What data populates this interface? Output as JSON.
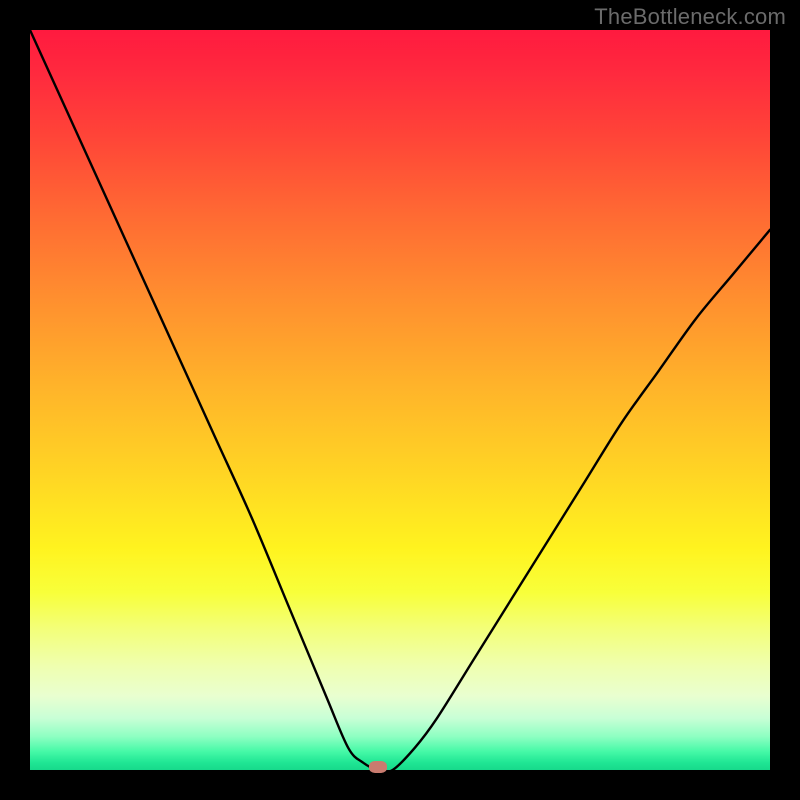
{
  "watermark": "TheBottleneck.com",
  "colors": {
    "frame": "#000000",
    "curve": "#000000",
    "marker": "#c97b6f",
    "gradient_top": "#ff1a3f",
    "gradient_bottom": "#17d98b"
  },
  "chart_data": {
    "type": "line",
    "title": "",
    "xlabel": "",
    "ylabel": "",
    "xlim": [
      0,
      100
    ],
    "ylim": [
      0,
      100
    ],
    "grid": false,
    "legend": false,
    "notes": "V-shaped bottleneck curve on a vertical red→green gradient. Minimum sits around x≈47 near y≈0. No axis ticks or labels are shown.",
    "series": [
      {
        "name": "bottleneck-curve",
        "x": [
          0,
          5,
          10,
          15,
          20,
          25,
          30,
          35,
          40,
          43,
          45,
          47,
          49,
          52,
          55,
          60,
          65,
          70,
          75,
          80,
          85,
          90,
          95,
          100
        ],
        "y": [
          100,
          89,
          78,
          67,
          56,
          45,
          34,
          22,
          10,
          3,
          1,
          0,
          0,
          3,
          7,
          15,
          23,
          31,
          39,
          47,
          54,
          61,
          67,
          73
        ]
      }
    ],
    "flat_minimum_x_range": [
      43,
      49
    ],
    "marker": {
      "x": 47,
      "y": 0
    }
  }
}
